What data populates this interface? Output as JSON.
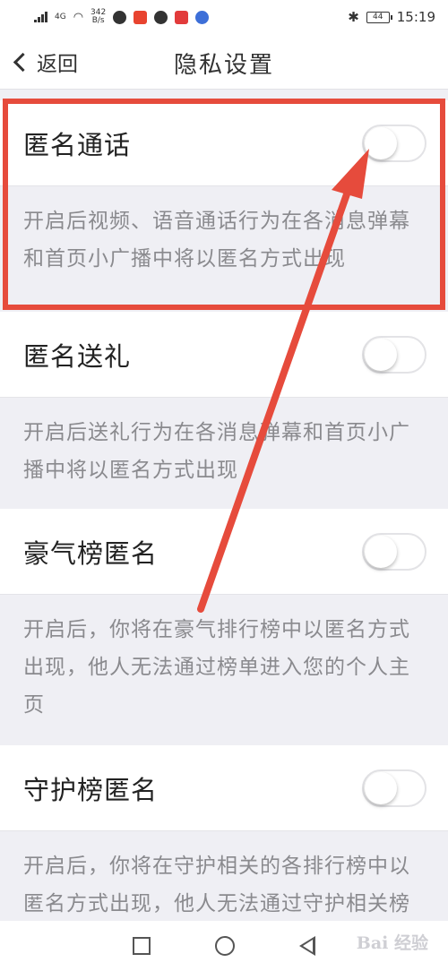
{
  "status_bar": {
    "network": "4G",
    "speed": "342",
    "speed_unit": "B/s",
    "battery": "44",
    "time": "15:19"
  },
  "nav": {
    "back_label": "返回",
    "title": "隐私设置"
  },
  "settings": [
    {
      "label": "匿名通话",
      "enabled": false,
      "description": "开启后视频、语音通话行为在各消息弹幕和首页小广播中将以匿名方式出现"
    },
    {
      "label": "匿名送礼",
      "enabled": false,
      "description": "开启后送礼行为在各消息弹幕和首页小广播中将以匿名方式出现"
    },
    {
      "label": "豪气榜匿名",
      "enabled": false,
      "description": "开启后，你将在豪气排行榜中以匿名方式出现，他人无法通过榜单进入您的个人主页"
    },
    {
      "label": "守护榜匿名",
      "enabled": false,
      "description": "开启后，你将在守护相关的各排行榜中以匿名方式出现，他人无法通过守护相关榜单进入您的个人主页"
    }
  ],
  "colors": {
    "annotation": "#e64b3c",
    "background": "#efeff4"
  },
  "watermark": "Bai 经验"
}
